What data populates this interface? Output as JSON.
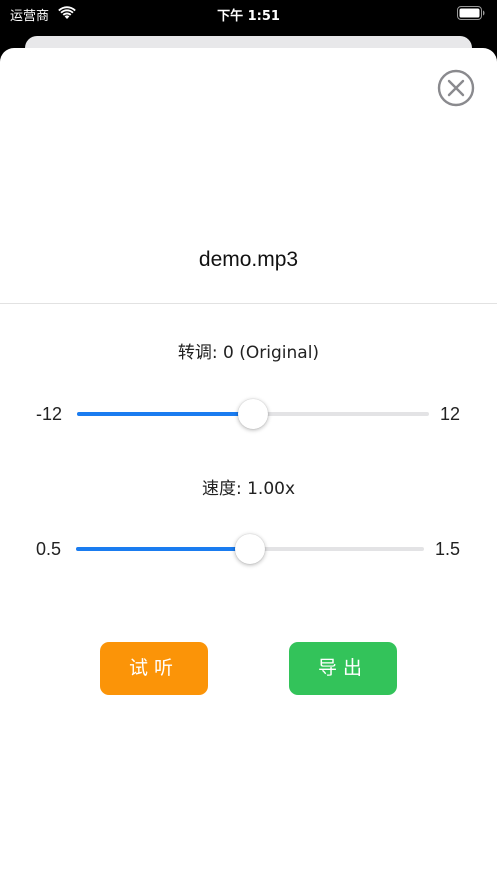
{
  "status_bar": {
    "carrier": "运营商",
    "time": "下午 1:51"
  },
  "sheet": {
    "file_name": "demo.mp3",
    "close_icon": "close-circle-icon"
  },
  "pitch": {
    "label": "转调: 0 (Original)",
    "min_label": "-12",
    "max_label": "12",
    "min": -12,
    "max": 12,
    "value": 0
  },
  "speed": {
    "label": "速度: 1.00x",
    "min_label": "0.5",
    "max_label": "1.5",
    "min": 0.5,
    "max": 1.5,
    "value": 1.0
  },
  "actions": {
    "listen_label": "试听",
    "export_label": "导出"
  },
  "colors": {
    "slider_fill": "#1a7cf0",
    "listen_button": "#fb9408",
    "export_button": "#33c35a"
  }
}
